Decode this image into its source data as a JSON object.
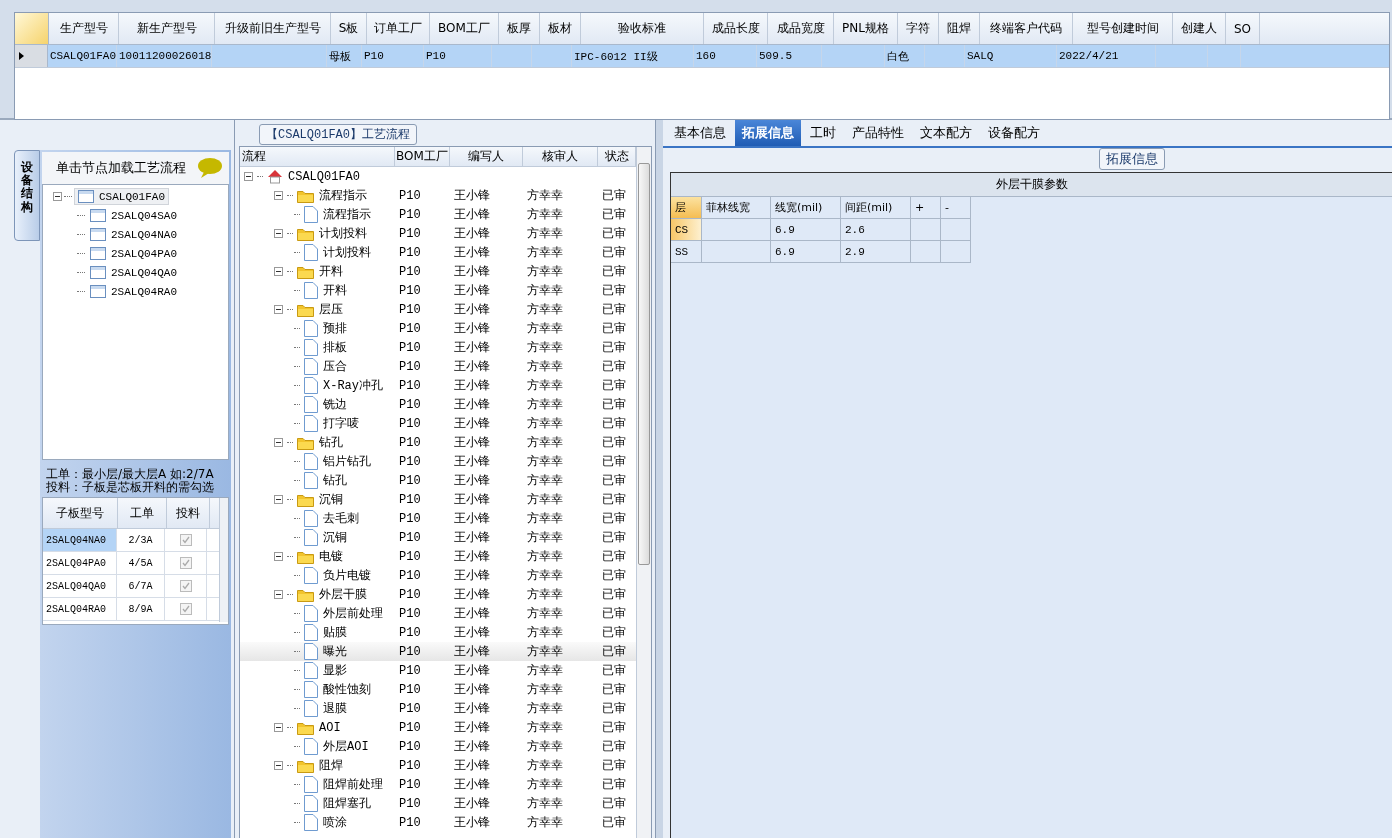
{
  "main_grid": {
    "columns": [
      "生产型号",
      "新生产型号",
      "升级前旧生产型号",
      "S板",
      "订单工厂",
      "BOM工厂",
      "板厚",
      "板材",
      "验收标准",
      "成品长度",
      "成品宽度",
      "PNL规格",
      "字符",
      "阻焊",
      "终端客户代码",
      "型号创建时间",
      "创建人",
      "SO"
    ],
    "rows": [
      {
        "selected": true,
        "cells": [
          "CSALQ01FA0",
          "10011200026018",
          "",
          "母板",
          "P10",
          "P10",
          "",
          "",
          "IPC-6012 II级",
          "160",
          "509.5",
          "",
          "白色",
          "",
          "SALQ",
          "2022/4/21",
          "",
          ""
        ]
      }
    ]
  },
  "side_panel": {
    "vertical_tab": "设备结构",
    "header": "单击节点加载工艺流程",
    "tree": {
      "label": "CSALQ01FA0",
      "expanded": true,
      "selected": true,
      "children": [
        {
          "label": "2SALQ04SA0",
          "selected": false
        },
        {
          "label": "2SALQ04NA0",
          "selected": false
        },
        {
          "label": "2SALQ04PA0",
          "selected": false
        },
        {
          "label": "2SALQ04QA0",
          "selected": false
        },
        {
          "label": "2SALQ04RA0",
          "selected": false
        }
      ]
    },
    "notes": [
      "工单：最小层/最大层A 如:2/7A",
      "投料：子板是芯板开料的需勾选"
    ],
    "grid": {
      "columns": [
        "子板型号",
        "工单",
        "投料"
      ],
      "rows": [
        {
          "cells": [
            "2SALQ04NA0",
            "2/3A"
          ],
          "checked": true,
          "selected": true
        },
        {
          "cells": [
            "2SALQ04PA0",
            "4/5A"
          ],
          "checked": true,
          "selected": false
        },
        {
          "cells": [
            "2SALQ04QA0",
            "6/7A"
          ],
          "checked": true,
          "selected": false
        },
        {
          "cells": [
            "2SALQ04RA0",
            "8/9A"
          ],
          "checked": true,
          "selected": false
        }
      ]
    }
  },
  "process": {
    "title": "【CSALQ01FA0】工艺流程",
    "columns": [
      "流程",
      "BOM工厂",
      "编写人",
      "核审人",
      "状态"
    ],
    "tree": {
      "label": "CSALQ01FA0",
      "kind": "home",
      "expanded": true,
      "selected": false,
      "children": [
        {
          "label": "流程指示",
          "kind": "folder",
          "expanded": true,
          "selected": false,
          "cells": [
            "P10",
            "王小锋",
            "方幸幸",
            "已审"
          ],
          "children": [
            {
              "label": "流程指示",
              "kind": "file",
              "selected": false,
              "cells": [
                "P10",
                "王小锋",
                "方幸幸",
                "已审"
              ]
            }
          ]
        },
        {
          "label": "计划投料",
          "kind": "folder",
          "expanded": true,
          "selected": false,
          "cells": [
            "P10",
            "王小锋",
            "方幸幸",
            "已审"
          ],
          "children": [
            {
              "label": "计划投料",
              "kind": "file",
              "selected": false,
              "cells": [
                "P10",
                "王小锋",
                "方幸幸",
                "已审"
              ]
            }
          ]
        },
        {
          "label": "开料",
          "kind": "folder",
          "expanded": true,
          "selected": false,
          "cells": [
            "P10",
            "王小锋",
            "方幸幸",
            "已审"
          ],
          "children": [
            {
              "label": "开料",
              "kind": "file",
              "selected": false,
              "cells": [
                "P10",
                "王小锋",
                "方幸幸",
                "已审"
              ]
            }
          ]
        },
        {
          "label": "层压",
          "kind": "folder",
          "expanded": true,
          "selected": false,
          "cells": [
            "P10",
            "王小锋",
            "方幸幸",
            "已审"
          ],
          "children": [
            {
              "label": "预排",
              "kind": "file",
              "selected": false,
              "cells": [
                "P10",
                "王小锋",
                "方幸幸",
                "已审"
              ]
            },
            {
              "label": "排板",
              "kind": "file",
              "selected": false,
              "cells": [
                "P10",
                "王小锋",
                "方幸幸",
                "已审"
              ]
            },
            {
              "label": "压合",
              "kind": "file",
              "selected": false,
              "cells": [
                "P10",
                "王小锋",
                "方幸幸",
                "已审"
              ]
            },
            {
              "label": "X-Ray冲孔",
              "kind": "file",
              "selected": false,
              "cells": [
                "P10",
                "王小锋",
                "方幸幸",
                "已审"
              ]
            },
            {
              "label": "铣边",
              "kind": "file",
              "selected": false,
              "cells": [
                "P10",
                "王小锋",
                "方幸幸",
                "已审"
              ]
            },
            {
              "label": "打字唛",
              "kind": "file",
              "selected": false,
              "cells": [
                "P10",
                "王小锋",
                "方幸幸",
                "已审"
              ]
            }
          ]
        },
        {
          "label": "钻孔",
          "kind": "folder",
          "expanded": true,
          "selected": false,
          "cells": [
            "P10",
            "王小锋",
            "方幸幸",
            "已审"
          ],
          "children": [
            {
              "label": "铝片钻孔",
              "kind": "file",
              "selected": false,
              "cells": [
                "P10",
                "王小锋",
                "方幸幸",
                "已审"
              ]
            },
            {
              "label": "钻孔",
              "kind": "file",
              "selected": false,
              "cells": [
                "P10",
                "王小锋",
                "方幸幸",
                "已审"
              ]
            }
          ]
        },
        {
          "label": "沉铜",
          "kind": "folder",
          "expanded": true,
          "selected": false,
          "cells": [
            "P10",
            "王小锋",
            "方幸幸",
            "已审"
          ],
          "children": [
            {
              "label": "去毛刺",
              "kind": "file",
              "selected": false,
              "cells": [
                "P10",
                "王小锋",
                "方幸幸",
                "已审"
              ]
            },
            {
              "label": "沉铜",
              "kind": "file",
              "selected": false,
              "cells": [
                "P10",
                "王小锋",
                "方幸幸",
                "已审"
              ]
            }
          ]
        },
        {
          "label": "电镀",
          "kind": "folder",
          "expanded": true,
          "selected": false,
          "cells": [
            "P10",
            "王小锋",
            "方幸幸",
            "已审"
          ],
          "children": [
            {
              "label": "负片电镀",
              "kind": "file",
              "selected": false,
              "cells": [
                "P10",
                "王小锋",
                "方幸幸",
                "已审"
              ]
            }
          ]
        },
        {
          "label": "外层干膜",
          "kind": "folder",
          "expanded": true,
          "selected": false,
          "cells": [
            "P10",
            "王小锋",
            "方幸幸",
            "已审"
          ],
          "children": [
            {
              "label": "外层前处理",
              "kind": "file",
              "selected": false,
              "cells": [
                "P10",
                "王小锋",
                "方幸幸",
                "已审"
              ]
            },
            {
              "label": "贴膜",
              "kind": "file",
              "selected": false,
              "cells": [
                "P10",
                "王小锋",
                "方幸幸",
                "已审"
              ]
            },
            {
              "label": "曝光",
              "kind": "file",
              "selected": true,
              "cells": [
                "P10",
                "王小锋",
                "方幸幸",
                "已审"
              ]
            },
            {
              "label": "显影",
              "kind": "file",
              "selected": false,
              "cells": [
                "P10",
                "王小锋",
                "方幸幸",
                "已审"
              ]
            },
            {
              "label": "酸性蚀刻",
              "kind": "file",
              "selected": false,
              "cells": [
                "P10",
                "王小锋",
                "方幸幸",
                "已审"
              ]
            },
            {
              "label": "退膜",
              "kind": "file",
              "selected": false,
              "cells": [
                "P10",
                "王小锋",
                "方幸幸",
                "已审"
              ]
            }
          ]
        },
        {
          "label": "AOI",
          "kind": "folder",
          "expanded": true,
          "selected": false,
          "cells": [
            "P10",
            "王小锋",
            "方幸幸",
            "已审"
          ],
          "children": [
            {
              "label": "外层AOI",
              "kind": "file",
              "selected": false,
              "cells": [
                "P10",
                "王小锋",
                "方幸幸",
                "已审"
              ]
            }
          ]
        },
        {
          "label": "阻焊",
          "kind": "folder",
          "expanded": true,
          "selected": false,
          "cells": [
            "P10",
            "王小锋",
            "方幸幸",
            "已审"
          ],
          "children": [
            {
              "label": "阻焊前处理",
              "kind": "file",
              "selected": false,
              "cells": [
                "P10",
                "王小锋",
                "方幸幸",
                "已审"
              ]
            },
            {
              "label": "阻焊塞孔",
              "kind": "file",
              "selected": false,
              "cells": [
                "P10",
                "王小锋",
                "方幸幸",
                "已审"
              ]
            },
            {
              "label": "喷涂",
              "kind": "file",
              "selected": false,
              "cells": [
                "P10",
                "王小锋",
                "方幸幸",
                "已审"
              ]
            }
          ]
        }
      ]
    }
  },
  "detail": {
    "tabs": [
      {
        "label": "基本信息",
        "selected": false
      },
      {
        "label": "拓展信息",
        "selected": true
      },
      {
        "label": "工时",
        "selected": false
      },
      {
        "label": "产品特性",
        "selected": false
      },
      {
        "label": "文本配方",
        "selected": false
      },
      {
        "label": "设备配方",
        "selected": false
      }
    ],
    "group_title": "拓展信息",
    "table": {
      "title": "外层干膜参数",
      "columns": [
        "层",
        "菲林线宽",
        "线宽(mil)",
        "间距(mil)",
        "+",
        "-"
      ],
      "rows": [
        {
          "selected": true,
          "cells": [
            "CS",
            "",
            "6.9",
            "2.6",
            "",
            ""
          ]
        },
        {
          "selected": false,
          "cells": [
            "SS",
            "",
            "6.9",
            "2.9",
            "",
            ""
          ]
        }
      ]
    }
  }
}
